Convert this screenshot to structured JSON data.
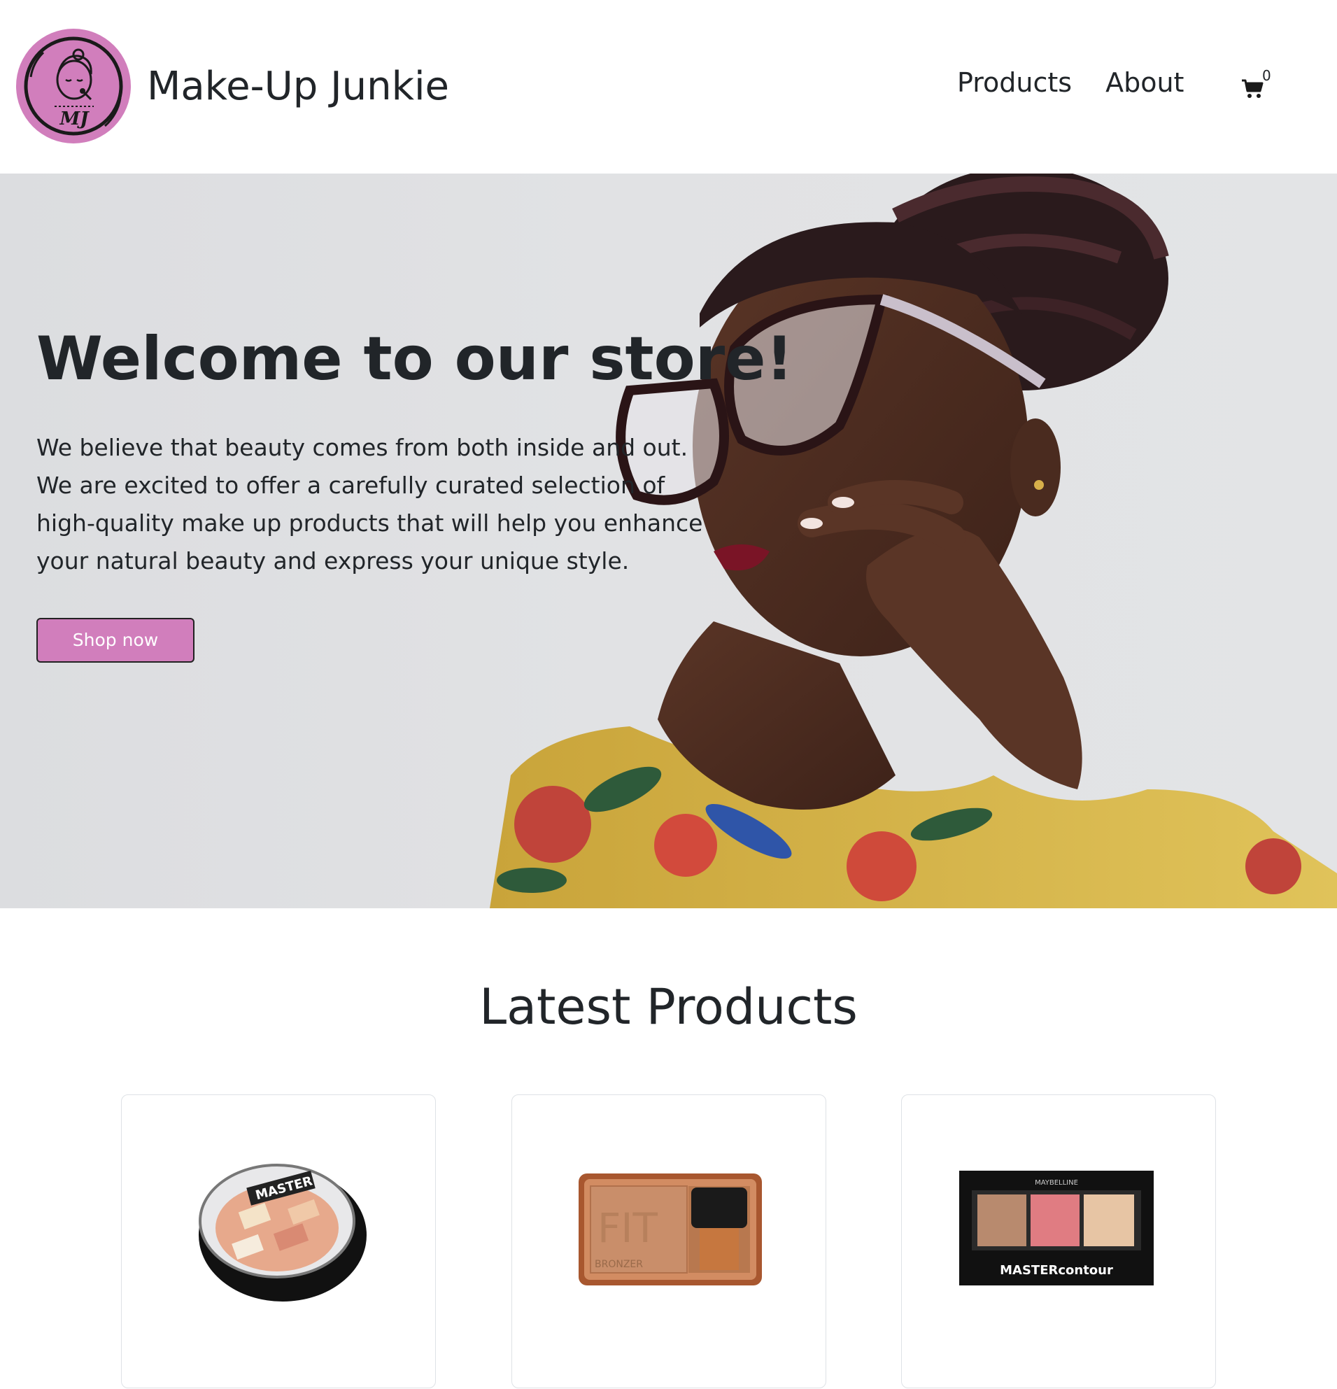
{
  "header": {
    "brand_name": "Make-Up Junkie",
    "logo_initials": "MJ",
    "nav": [
      {
        "label": "Products"
      },
      {
        "label": "About"
      }
    ],
    "cart_count": "0",
    "cart_icon": "shopping-cart-icon"
  },
  "hero": {
    "title": "Welcome to our store!",
    "description": "We believe that beauty comes from both inside and out. We are excited to offer a carefully curated selection of high-quality make up products that will help you enhance your natural beauty and express your unique style.",
    "button_label": "Shop now"
  },
  "latest": {
    "title": "Latest Products",
    "products": [
      {
        "image": "maybelline-facestudio-highlighter-compact"
      },
      {
        "image": "fit-me-bronzer-with-brush"
      },
      {
        "image": "master-contour-palette"
      }
    ]
  },
  "colors": {
    "accent": "#d17ebc",
    "text": "#212529",
    "hero_bg": "#e1e2e4"
  }
}
